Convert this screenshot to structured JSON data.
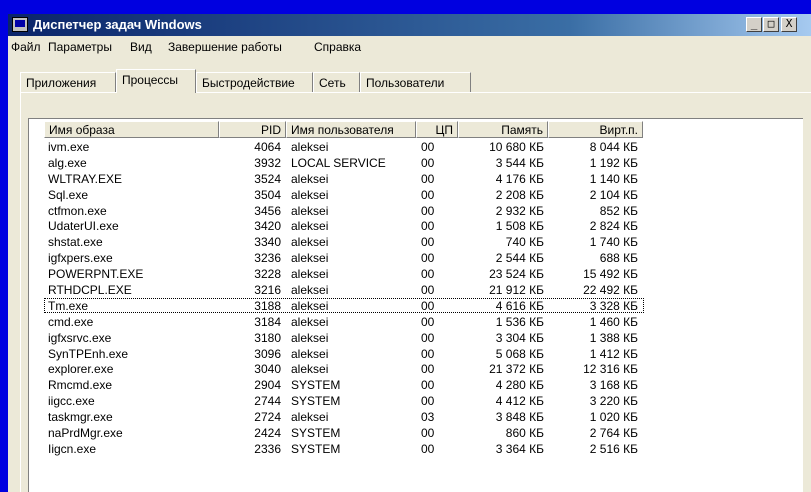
{
  "window": {
    "title": "Диспетчер задач Windows",
    "buttons": {
      "minimize": "_",
      "maximize": "□",
      "close": "X"
    }
  },
  "menu": [
    "Файл",
    "Параметры",
    "Вид",
    "Завершение работы",
    "Справка"
  ],
  "tabs": [
    {
      "label": "Приложения",
      "active": false
    },
    {
      "label": "Процессы",
      "active": true
    },
    {
      "label": "Быстродействие",
      "active": false
    },
    {
      "label": "Сеть",
      "active": false
    },
    {
      "label": "Пользователи",
      "active": false
    }
  ],
  "table": {
    "columns": [
      "Имя образа",
      "PID",
      "Имя пользователя",
      "ЦП",
      "Память",
      "Вирт.п."
    ],
    "focused_row": 10,
    "rows": [
      [
        "ivm.exe",
        "4064",
        "aleksei",
        "00",
        "10 680 КБ",
        "8 044 КБ"
      ],
      [
        "alg.exe",
        "3932",
        "LOCAL SERVICE",
        "00",
        "3 544 КБ",
        "1 192 КБ"
      ],
      [
        "WLTRAY.EXE",
        "3524",
        "aleksei",
        "00",
        "4 176 КБ",
        "1 140 КБ"
      ],
      [
        "Sql.exe",
        "3504",
        "aleksei",
        "00",
        "2 208 КБ",
        "2 104 КБ"
      ],
      [
        "ctfmon.exe",
        "3456",
        "aleksei",
        "00",
        "2 932 КБ",
        "852 КБ"
      ],
      [
        "UdaterUI.exe",
        "3420",
        "aleksei",
        "00",
        "1 508 КБ",
        "2 824 КБ"
      ],
      [
        "shstat.exe",
        "3340",
        "aleksei",
        "00",
        "740 КБ",
        "1 740 КБ"
      ],
      [
        "igfxpers.exe",
        "3236",
        "aleksei",
        "00",
        "2 544 КБ",
        "688 КБ"
      ],
      [
        "POWERPNT.EXE",
        "3228",
        "aleksei",
        "00",
        "23 524 КБ",
        "15 492 КБ"
      ],
      [
        "RTHDCPL.EXE",
        "3216",
        "aleksei",
        "00",
        "21 912 КБ",
        "22 492 КБ"
      ],
      [
        "Tm.exe",
        "3188",
        "aleksei",
        "00",
        "4 616 КБ",
        "3 328 КБ"
      ],
      [
        "cmd.exe",
        "3184",
        "aleksei",
        "00",
        "1 536 КБ",
        "1 460 КБ"
      ],
      [
        "igfxsrvc.exe",
        "3180",
        "aleksei",
        "00",
        "3 304 КБ",
        "1 388 КБ"
      ],
      [
        "SynTPEnh.exe",
        "3096",
        "aleksei",
        "00",
        "5 068 КБ",
        "1 412 КБ"
      ],
      [
        "explorer.exe",
        "3040",
        "aleksei",
        "00",
        "21 372 КБ",
        "12 316 КБ"
      ],
      [
        "Rmcmd.exe",
        "2904",
        "SYSTEM",
        "00",
        "4 280 КБ",
        "3 168 КБ"
      ],
      [
        "iigcc.exe",
        "2744",
        "SYSTEM",
        "00",
        "4 412 КБ",
        "3 220 КБ"
      ],
      [
        "taskmgr.exe",
        "2724",
        "aleksei",
        "03",
        "3 848 КБ",
        "1 020 КБ"
      ],
      [
        "naPrdMgr.exe",
        "2424",
        "SYSTEM",
        "00",
        "860 КБ",
        "2 764 КБ"
      ],
      [
        "Iigcn.exe",
        "2336",
        "SYSTEM",
        "00",
        "3 364 КБ",
        "2 516 КБ"
      ]
    ]
  }
}
